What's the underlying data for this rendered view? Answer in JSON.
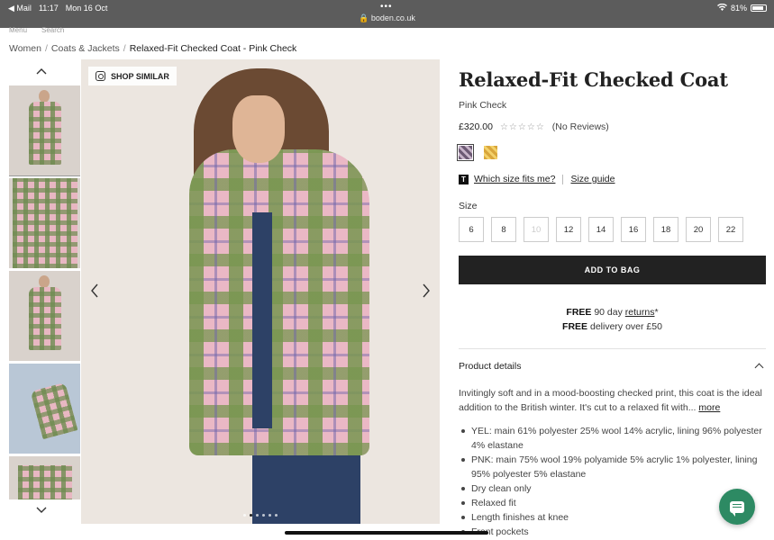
{
  "status": {
    "back_app": "◀ Mail",
    "time": "11:17",
    "date": "Mon 16 Oct",
    "dots": "•••",
    "url": "🔒 boden.co.uk",
    "battery": "81%"
  },
  "nav_peek": [
    "Menu",
    "Search"
  ],
  "breadcrumb": {
    "items": [
      "Women",
      "Coats & Jackets",
      "Relaxed-Fit Checked Coat - Pink Check"
    ],
    "separator": "/"
  },
  "gallery": {
    "shop_similar_label": "SHOP SIMILAR",
    "up_icon": "chevron-up-icon",
    "down_icon": "chevron-down-icon",
    "prev_icon": "chevron-left-icon",
    "next_icon": "chevron-right-icon",
    "thumbnail_count": 5,
    "active_dot": 1,
    "dot_count": 6
  },
  "product": {
    "title": "Relaxed-Fit Checked Coat",
    "colour": "Pink Check",
    "price": "£320.00",
    "stars": "☆☆☆☆☆",
    "reviews": "(No Reviews)",
    "swatches": [
      {
        "name": "Pink Check",
        "color": "#8b7a92",
        "selected": true
      },
      {
        "name": "Yellow",
        "color": "#e2b54a",
        "selected": false
      }
    ],
    "size_help_badge": "T",
    "which_size_label": "Which size fits me?",
    "size_guide_label": "Size guide",
    "size_label": "Size",
    "sizes": [
      {
        "label": "6",
        "available": true
      },
      {
        "label": "8",
        "available": true
      },
      {
        "label": "10",
        "available": false
      },
      {
        "label": "12",
        "available": true
      },
      {
        "label": "14",
        "available": true
      },
      {
        "label": "16",
        "available": true
      },
      {
        "label": "18",
        "available": true
      },
      {
        "label": "20",
        "available": true
      },
      {
        "label": "22",
        "available": true
      }
    ],
    "add_to_bag_label": "ADD TO BAG",
    "delivery": {
      "line1_bold": "FREE",
      "line1_text": " 90 day ",
      "line1_link": "returns",
      "line1_suffix": "*",
      "line2_bold": "FREE",
      "line2_text": " delivery over £50"
    },
    "details_heading": "Product details",
    "description": "Invitingly soft and in a mood-boosting checked print, this coat is the ideal addition to the British winter. It's cut to a relaxed fit with... ",
    "more_label": "more",
    "bullets": [
      "YEL: main 61% polyester 25% wool 14% acrylic, lining 96% polyester 4% elastane",
      "PNK: main 75% wool 19% polyamide 5% acrylic 1% polyester, lining 95% polyester 5% elastane",
      "Dry clean only",
      "Relaxed fit",
      "Length finishes at knee",
      "Front pockets"
    ]
  },
  "colors": {
    "add_to_bag_bg": "#222222",
    "chat_bg": "#2d8a63",
    "status_bar_bg": "#5c5c5c"
  }
}
